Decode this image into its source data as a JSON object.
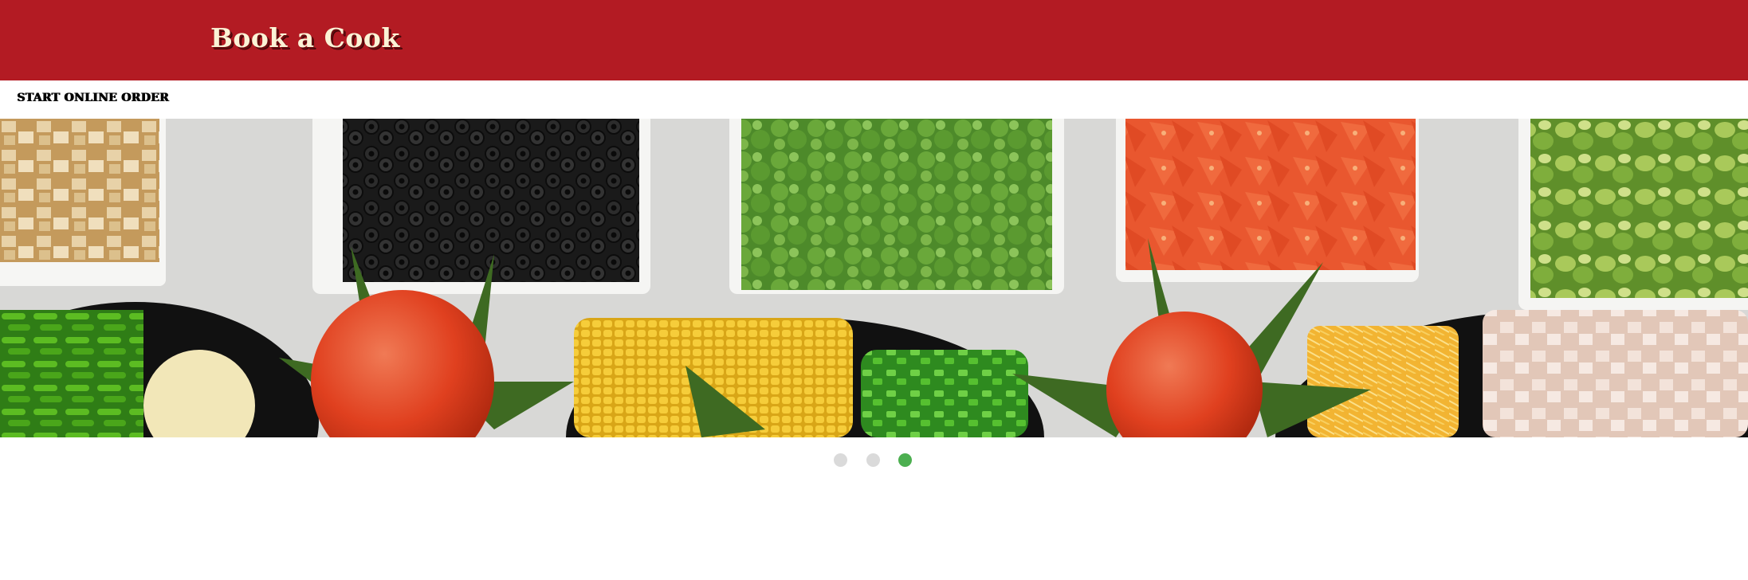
{
  "header": {
    "brand": "Book a Cook",
    "background_color": "#b31b23",
    "brand_color": "#fbf3d6"
  },
  "nav": {
    "start_order_label": "START ONLINE ORDER"
  },
  "carousel": {
    "slide_count": 3,
    "active_index": 2,
    "active_dot_color": "#4caf50",
    "inactive_dot_color": "#dadada",
    "slide_image": "salad-bar-ingredients-photo"
  }
}
